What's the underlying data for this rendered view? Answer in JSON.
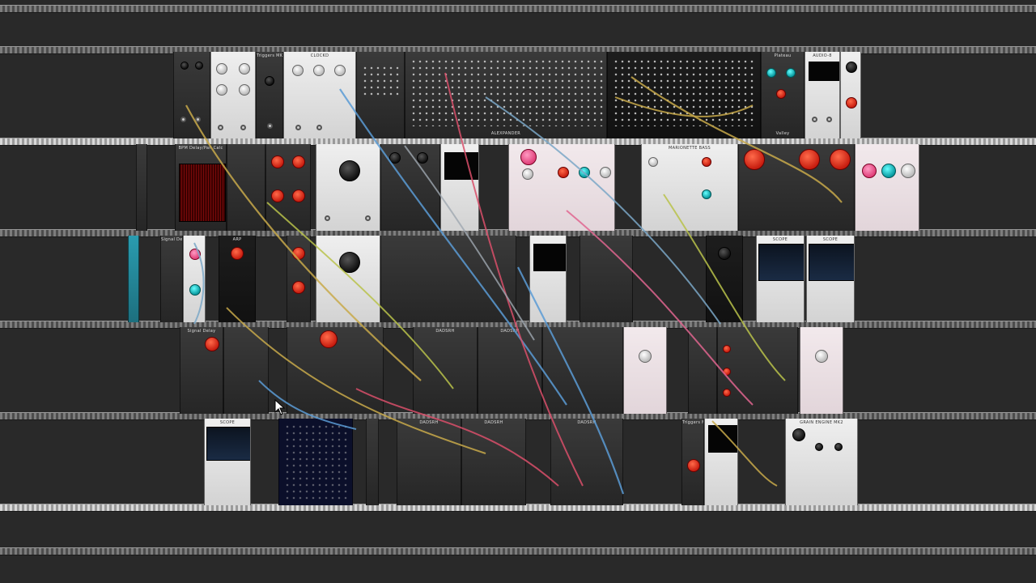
{
  "app": {
    "name": "VCV Rack patch view"
  },
  "colors": {
    "rack_bg": "#292929",
    "wire_palette": [
      "#c8a94a",
      "#5b9bd5",
      "#d94f6a",
      "#9fa7b0",
      "#7aa7c7",
      "#b8c24a",
      "#e0658f"
    ]
  },
  "rows": [
    {
      "id": "row1",
      "modules": [
        {
          "label": "",
          "theme": "dark"
        },
        {
          "label": "",
          "theme": "light"
        },
        {
          "label": "Triggers MKII",
          "theme": "dark"
        },
        {
          "label": "CLOCKD",
          "theme": "light"
        },
        {
          "label": "",
          "theme": "dark"
        },
        {
          "label": "",
          "theme": "dark"
        },
        {
          "label": "",
          "theme": "black"
        },
        {
          "label": "Plateau",
          "theme": "dark"
        },
        {
          "label": "AUDIO-8",
          "theme": "light"
        },
        {
          "label": "",
          "theme": "light"
        }
      ],
      "texts": {
        "mixer_brand": "ALEXPANDER",
        "valley": "Valley"
      }
    },
    {
      "id": "row2",
      "modules": [
        {
          "label": "",
          "theme": "dark"
        },
        {
          "label": "BPM Delay/Pan Calc",
          "theme": "dark"
        },
        {
          "label": "",
          "theme": "dark"
        },
        {
          "label": "",
          "theme": "dark"
        },
        {
          "label": "",
          "theme": "light"
        },
        {
          "label": "",
          "theme": "dark"
        },
        {
          "label": "",
          "theme": "dark"
        },
        {
          "label": "",
          "theme": "light"
        },
        {
          "label": "",
          "theme": "pink"
        },
        {
          "label": "MARIONETTE BASS",
          "theme": "light"
        },
        {
          "label": "",
          "theme": "dark"
        },
        {
          "label": "",
          "theme": "pink"
        }
      ]
    },
    {
      "id": "row3",
      "modules": [
        {
          "label": "",
          "theme": "teal"
        },
        {
          "label": "Signal Delay",
          "theme": "dark"
        },
        {
          "label": "",
          "theme": "light"
        },
        {
          "label": "ARP",
          "theme": "black"
        },
        {
          "label": "",
          "theme": "dark"
        },
        {
          "label": "",
          "theme": "light"
        },
        {
          "label": "",
          "theme": "dark"
        },
        {
          "label": "",
          "theme": "dark"
        },
        {
          "label": "",
          "theme": "dark"
        },
        {
          "label": "",
          "theme": "dark"
        },
        {
          "label": "",
          "theme": "black"
        },
        {
          "label": "SCOPE",
          "theme": "light"
        },
        {
          "label": "SCOPE",
          "theme": "light"
        }
      ]
    },
    {
      "id": "row4",
      "modules": [
        {
          "label": "Signal Delay",
          "theme": "dark"
        },
        {
          "label": "",
          "theme": "dark"
        },
        {
          "label": "",
          "theme": "dark"
        },
        {
          "label": "DADSRH",
          "theme": "dark"
        },
        {
          "label": "DADSRH",
          "theme": "dark"
        },
        {
          "label": "",
          "theme": "dark"
        },
        {
          "label": "",
          "theme": "pink"
        },
        {
          "label": "",
          "theme": "dark"
        },
        {
          "label": "",
          "theme": "dark"
        },
        {
          "label": "",
          "theme": "pink"
        }
      ]
    },
    {
      "id": "row5",
      "modules": [
        {
          "label": "SCOPE",
          "theme": "light"
        },
        {
          "label": "",
          "theme": "navy"
        },
        {
          "label": "",
          "theme": "dark"
        },
        {
          "label": "DADSRH",
          "theme": "dark"
        },
        {
          "label": "DADSRH",
          "theme": "dark"
        },
        {
          "label": "DADSRH",
          "theme": "dark"
        },
        {
          "label": "Triggers MKII",
          "theme": "dark"
        },
        {
          "label": "",
          "theme": "light"
        },
        {
          "label": "GRAIN ENGINE MK2",
          "theme": "light"
        }
      ]
    }
  ]
}
